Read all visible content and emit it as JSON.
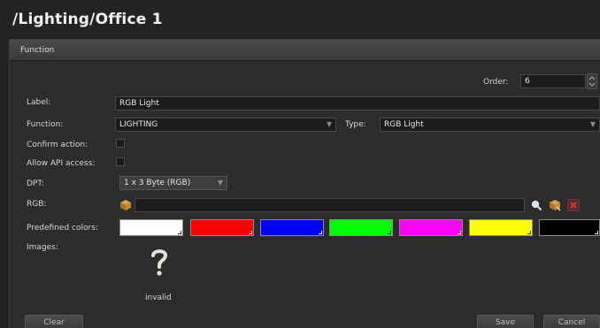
{
  "page": {
    "title": "/Lighting/Office 1"
  },
  "dialog": {
    "header": "Function"
  },
  "order": {
    "label": "Order:",
    "value": "6"
  },
  "label_field": {
    "label": "Label:",
    "value": "RGB Light"
  },
  "function_field": {
    "label": "Function:",
    "value": "LIGHTING"
  },
  "type_field": {
    "label": "Type:",
    "value": "RGB Light"
  },
  "confirm_action": {
    "label": "Confirm action:"
  },
  "allow_api": {
    "label": "Allow API access:"
  },
  "dpt": {
    "label": "DPT:",
    "value": "1 x 3 Byte (RGB)"
  },
  "rgb": {
    "label": "RGB:",
    "value": ""
  },
  "predefined": {
    "label": "Predefined colors:",
    "colors": [
      "#ffffff",
      "#ff0000",
      "#0000ff",
      "#00ff00",
      "#ff00ff",
      "#ffff00",
      "#000000"
    ]
  },
  "images": {
    "label": "Images:",
    "caption": "invalid"
  },
  "buttons": {
    "clear": "Clear",
    "save": "Save",
    "cancel": "Cancel"
  },
  "icons": {
    "rgb_picker": "color-cube-icon",
    "search": "magnifier-icon",
    "edit": "edit-icon",
    "delete": "delete-icon",
    "image_placeholder": "question-mark-icon"
  }
}
